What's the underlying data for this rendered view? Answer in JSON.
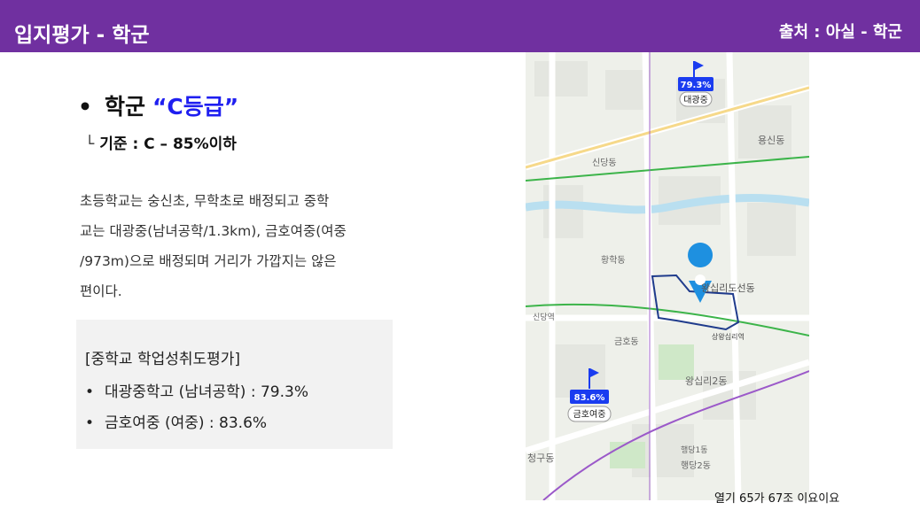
{
  "header": {
    "title": "입지평가 - 학군",
    "source": "출처 : 아실 - 학군"
  },
  "grade": {
    "bullet": "•",
    "label": "학군",
    "value": "“C등급”"
  },
  "criteria": {
    "prefix": "└",
    "text": "기준 : C – 85%이하"
  },
  "description": [
    "초등학교는 숭신초, 무학초로 배정되고 중학",
    "교는 대광중(남녀공학/1.3km), 금호여중(여중",
    "/973m)으로 배정되며 거리가 가깝지는 않은",
    "편이다."
  ],
  "evaluation": {
    "title": "[중학교 학업성취도평가]",
    "items": [
      {
        "bullet": "•",
        "text": "대광중학고 (남녀공학) : 79.3%"
      },
      {
        "bullet": "•",
        "text": "금호여중 (여중) : 83.6%"
      }
    ]
  },
  "map": {
    "flags": [
      {
        "percent": "79.3%",
        "school": "대광중"
      },
      {
        "percent": "83.6%",
        "school": "금호여중"
      }
    ],
    "labels": {
      "l1": "신당역",
      "l2": "신당동",
      "l3": "황학동",
      "l4": "용신동",
      "l5": "왕십리도선동",
      "l6": "왕십리2동",
      "l7": "행당2동",
      "l8": "금호동",
      "l9": "상왕십리역",
      "l10": "청구동",
      "l11": "행당1동"
    },
    "colors": {
      "flag": "#1a3cf0",
      "pin": "#1e90e0",
      "boundary": "#1f3b8c",
      "road": "#ffffff",
      "river": "#b9dff0",
      "subway_green": "#3cb44a",
      "subway_purple": "#9b59c9"
    }
  },
  "footer": {
    "note": "열기 65가 67조 이요이요"
  }
}
